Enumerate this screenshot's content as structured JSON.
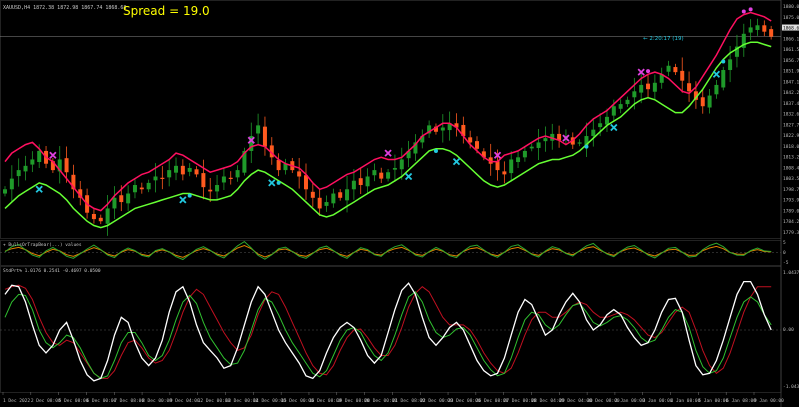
{
  "header": {
    "symbol_line": "XAUUSD,H4 1872.38 1872.98 1867.74 1868.68",
    "spread_label": "Spread = 19.0",
    "timer_label": "← 2:20:17 (19)"
  },
  "colors": {
    "background": "#000000",
    "bull_candle": "#1f9a2a",
    "bear_candle": "#ff5a1f",
    "upper_band": "#ff1060",
    "lower_band": "#66ff33",
    "arrow_cyan": "#22c8e0",
    "arrow_magenta": "#e040e0",
    "spread_text": "#ffff00",
    "axis_text": "#bbbbbb"
  },
  "chart_data": [
    {
      "type": "candlestick",
      "panel": "main",
      "title": "XAUUSD,H4",
      "y_ticks": [
        "1880.00",
        "1875.00",
        "1868.68",
        "1866.15",
        "1861.50",
        "1856.75",
        "1851.90",
        "1847.10",
        "1842.25",
        "1837.40",
        "1832.60",
        "1827.75",
        "1822.90",
        "1818.05",
        "1813.25",
        "1808.40",
        "1803.55",
        "1798.70",
        "1793.90",
        "1789.05",
        "1784.20",
        "1779.35"
      ],
      "current_price": "1868.68",
      "ylim": [
        1776,
        1884
      ],
      "close": [
        1797,
        1802,
        1806,
        1808,
        1811,
        1815,
        1809,
        1806,
        1811,
        1805,
        1797,
        1793,
        1786,
        1783,
        1782,
        1788,
        1793,
        1791,
        1795,
        1799,
        1797,
        1800,
        1803,
        1802,
        1806,
        1808,
        1804,
        1807,
        1804,
        1798,
        1796,
        1799,
        1803,
        1802,
        1806,
        1815,
        1822,
        1827,
        1817,
        1812,
        1806,
        1809,
        1806,
        1803,
        1797,
        1793,
        1788,
        1791,
        1795,
        1793,
        1797,
        1801,
        1799,
        1803,
        1806,
        1802,
        1805,
        1807,
        1811,
        1815,
        1819,
        1822,
        1827,
        1824,
        1826,
        1828,
        1826,
        1822,
        1819,
        1816,
        1812,
        1809,
        1806,
        1804,
        1811,
        1812,
        1815,
        1817,
        1819,
        1821,
        1823,
        1820,
        1822,
        1818,
        1819,
        1822,
        1825,
        1828,
        1831,
        1836,
        1837,
        1839,
        1843,
        1846,
        1844,
        1847,
        1851,
        1855,
        1852,
        1848,
        1843,
        1839,
        1836,
        1841,
        1846,
        1853,
        1858,
        1864,
        1870,
        1873,
        1874,
        1871,
        1868.68
      ],
      "series": [
        {
          "name": "upper_band",
          "values": [
            1810,
            1814,
            1816,
            1818,
            1819,
            1816,
            1812,
            1810,
            1806,
            1802,
            1798,
            1794,
            1790,
            1788,
            1787,
            1790,
            1794,
            1797,
            1800,
            1802,
            1804,
            1805,
            1807,
            1809,
            1811,
            1814,
            1813,
            1811,
            1809,
            1807,
            1805,
            1806,
            1807,
            1808,
            1810,
            1814,
            1817,
            1818,
            1817,
            1814,
            1811,
            1809,
            1808,
            1807,
            1804,
            1800,
            1797,
            1798,
            1800,
            1802,
            1804,
            1805,
            1807,
            1809,
            1811,
            1812,
            1811,
            1811,
            1812,
            1815,
            1818,
            1822,
            1824,
            1826,
            1828,
            1828,
            1826,
            1822,
            1818,
            1815,
            1812,
            1810,
            1810,
            1813,
            1814,
            1815,
            1817,
            1819,
            1821,
            1822,
            1821,
            1820,
            1818,
            1820,
            1823,
            1827,
            1830,
            1832,
            1834,
            1837,
            1840,
            1843,
            1846,
            1849,
            1851,
            1852,
            1851,
            1849,
            1846,
            1843,
            1842,
            1845,
            1850,
            1855,
            1860,
            1866,
            1872,
            1877,
            1879,
            1880,
            1879,
            1878,
            1876
          ]
        },
        {
          "name": "lower_band",
          "values": [
            1788,
            1791,
            1794,
            1796,
            1798,
            1800,
            1799,
            1797,
            1795,
            1792,
            1788,
            1785,
            1782,
            1780,
            1779,
            1780,
            1782,
            1784,
            1786,
            1788,
            1789,
            1790,
            1791,
            1792,
            1793,
            1794,
            1795,
            1795,
            1794,
            1793,
            1792,
            1792,
            1793,
            1794,
            1797,
            1801,
            1804,
            1806,
            1805,
            1803,
            1801,
            1799,
            1797,
            1794,
            1791,
            1788,
            1785,
            1784,
            1785,
            1787,
            1789,
            1791,
            1793,
            1795,
            1797,
            1798,
            1799,
            1801,
            1803,
            1806,
            1809,
            1812,
            1815,
            1816,
            1816,
            1815,
            1813,
            1810,
            1807,
            1804,
            1801,
            1799,
            1798,
            1799,
            1801,
            1803,
            1805,
            1807,
            1809,
            1810,
            1811,
            1811,
            1812,
            1813,
            1815,
            1818,
            1821,
            1824,
            1827,
            1829,
            1831,
            1834,
            1837,
            1839,
            1840,
            1839,
            1837,
            1835,
            1833,
            1833,
            1836,
            1840,
            1844,
            1849,
            1854,
            1858,
            1861,
            1863,
            1865,
            1866,
            1866,
            1865,
            1864
          ]
        }
      ]
    },
    {
      "type": "line",
      "panel": "oscillator",
      "title": "+ BullsOrTrapBear(...) values",
      "y_ticks": [
        "5",
        "0",
        "-5"
      ],
      "series": [
        {
          "name": "green",
          "values": [
            0.2,
            1.8,
            2.5,
            0.8,
            -0.8,
            -1.5,
            0.5,
            1.6,
            0.4,
            -1.2,
            -1.8,
            -0.4,
            1.1,
            2.3,
            0.9,
            -0.8,
            -1.6,
            0.3,
            1.4,
            0.6,
            -0.9,
            -1.4,
            0.6,
            1.2,
            0.2,
            -1.3,
            -2.2,
            -0.6,
            1.0,
            1.8,
            0.7,
            -0.8,
            -1.7,
            0.2,
            2.1,
            3.4,
            1.4,
            -0.9,
            -2.1,
            -0.7,
            1.2,
            1.7,
            0.3,
            -1.2,
            -1.8,
            -0.3,
            1.4,
            2.0,
            0.6,
            -0.9,
            -1.8,
            0.0,
            1.5,
            0.9,
            -0.7,
            -1.2,
            0.7,
            1.8,
            2.4,
            0.9,
            -0.8,
            -1.4,
            0.3,
            1.6,
            0.6,
            -1.0,
            -1.6,
            0.4,
            1.9,
            2.3,
            0.8,
            -0.7,
            -1.5,
            0.1,
            1.9,
            2.4,
            1.0,
            -0.6,
            -1.4,
            0.5,
            1.8,
            1.2,
            -0.3,
            -1.1,
            0.6,
            2.1,
            2.8,
            1.0,
            -0.5,
            -1.3,
            0.4,
            1.7,
            2.2,
            0.8,
            -0.8,
            -1.7,
            -0.2,
            1.3,
            1.6,
            0.1,
            -1.4,
            -1.2,
            0.9,
            2.2,
            2.9,
            1.8,
            0.0,
            -0.8,
            -0.9,
            0.6,
            1.4,
            0.5,
            0.3
          ]
        },
        {
          "name": "orange",
          "values": [
            0.4,
            1.2,
            1.6,
            0.9,
            -0.3,
            -1.0,
            0.1,
            1.0,
            0.5,
            -0.7,
            -1.2,
            -0.3,
            0.7,
            1.5,
            0.8,
            -0.5,
            -1.1,
            0.1,
            0.9,
            0.4,
            -0.6,
            -1.0,
            0.3,
            0.8,
            0.2,
            -0.9,
            -1.5,
            -0.5,
            0.6,
            1.2,
            0.6,
            -0.5,
            -1.1,
            0.1,
            1.4,
            2.2,
            1.2,
            -0.5,
            -1.4,
            -0.6,
            0.8,
            1.1,
            0.3,
            -0.8,
            -1.2,
            -0.2,
            0.9,
            1.3,
            0.5,
            -0.6,
            -1.2,
            0.0,
            1.0,
            0.6,
            -0.5,
            -0.8,
            0.4,
            1.2,
            1.6,
            0.7,
            -0.5,
            -0.9,
            0.2,
            1.0,
            0.4,
            -0.7,
            -1.1,
            0.3,
            1.2,
            1.5,
            0.6,
            -0.5,
            -1.0,
            0.1,
            1.2,
            1.6,
            0.7,
            -0.4,
            -0.9,
            0.3,
            1.2,
            0.8,
            -0.2,
            -0.7,
            0.4,
            1.4,
            1.8,
            0.7,
            -0.3,
            -0.9,
            0.3,
            1.1,
            1.4,
            0.5,
            -0.5,
            -1.1,
            -0.1,
            0.8,
            1.0,
            0.1,
            -0.9,
            -0.8,
            0.6,
            1.4,
            1.9,
            1.2,
            0.0,
            -0.5,
            -0.6,
            0.4,
            0.9,
            0.3,
            0.2
          ]
        }
      ]
    },
    {
      "type": "line",
      "panel": "stochastic",
      "title": "StdPrt% 1.0176 0.2541 -0.4697 0.0500",
      "y_ticks": [
        "1.04372",
        "0.00",
        "-1.04372"
      ],
      "ylim": [
        -1.1,
        1.1
      ],
      "series": [
        {
          "name": "white",
          "values": [
            0.7,
            0.88,
            0.85,
            0.55,
            0.1,
            -0.3,
            -0.45,
            -0.3,
            0.0,
            0.15,
            -0.2,
            -0.6,
            -0.88,
            -1.0,
            -0.95,
            -0.6,
            -0.1,
            0.25,
            0.15,
            -0.25,
            -0.55,
            -0.7,
            -0.55,
            -0.2,
            0.35,
            0.75,
            0.85,
            0.55,
            0.1,
            -0.25,
            -0.4,
            -0.55,
            -0.75,
            -0.7,
            -0.35,
            0.1,
            0.55,
            0.85,
            0.7,
            0.35,
            0.0,
            -0.25,
            -0.45,
            -0.65,
            -0.9,
            -0.95,
            -0.8,
            -0.45,
            -0.15,
            0.05,
            0.15,
            0.05,
            -0.2,
            -0.5,
            -0.65,
            -0.5,
            -0.05,
            0.4,
            0.78,
            0.92,
            0.7,
            0.25,
            -0.15,
            -0.3,
            -0.15,
            0.05,
            0.15,
            0.0,
            -0.3,
            -0.6,
            -0.8,
            -0.9,
            -0.85,
            -0.55,
            -0.1,
            0.35,
            0.6,
            0.5,
            0.2,
            -0.1,
            0.0,
            0.3,
            0.55,
            0.72,
            0.55,
            0.2,
            0.0,
            0.1,
            0.3,
            0.4,
            0.3,
            0.05,
            -0.15,
            -0.3,
            -0.25,
            0.0,
            0.35,
            0.6,
            0.62,
            0.35,
            -0.2,
            -0.7,
            -0.88,
            -0.85,
            -0.6,
            -0.2,
            0.25,
            0.7,
            0.95,
            0.95,
            0.7,
            0.3,
            0.0
          ]
        },
        {
          "name": "green",
          "values": [
            0.25,
            0.55,
            0.7,
            0.68,
            0.4,
            0.0,
            -0.25,
            -0.35,
            -0.25,
            -0.1,
            -0.15,
            -0.35,
            -0.62,
            -0.85,
            -0.95,
            -0.9,
            -0.6,
            -0.25,
            -0.05,
            -0.05,
            -0.25,
            -0.5,
            -0.6,
            -0.5,
            -0.2,
            0.2,
            0.55,
            0.68,
            0.52,
            0.15,
            -0.15,
            -0.35,
            -0.55,
            -0.68,
            -0.65,
            -0.4,
            0.0,
            0.4,
            0.62,
            0.55,
            0.3,
            0.0,
            -0.25,
            -0.45,
            -0.65,
            -0.85,
            -0.92,
            -0.8,
            -0.5,
            -0.2,
            0.0,
            0.05,
            -0.05,
            -0.3,
            -0.5,
            -0.6,
            -0.45,
            -0.1,
            0.3,
            0.65,
            0.75,
            0.55,
            0.2,
            -0.05,
            -0.15,
            -0.1,
            0.02,
            0.05,
            -0.1,
            -0.35,
            -0.6,
            -0.78,
            -0.9,
            -0.85,
            -0.55,
            -0.15,
            0.2,
            0.35,
            0.3,
            0.1,
            0.0,
            0.1,
            0.3,
            0.48,
            0.52,
            0.35,
            0.15,
            0.08,
            0.15,
            0.25,
            0.28,
            0.2,
            0.05,
            -0.15,
            -0.25,
            -0.2,
            0.0,
            0.25,
            0.4,
            0.35,
            0.05,
            -0.4,
            -0.72,
            -0.85,
            -0.8,
            -0.55,
            -0.15,
            0.25,
            0.55,
            0.65,
            0.55,
            0.3,
            0.1
          ]
        },
        {
          "name": "red",
          "values": [
            0.8,
            0.85,
            0.88,
            0.82,
            0.6,
            0.25,
            -0.05,
            -0.25,
            -0.3,
            -0.2,
            -0.25,
            -0.45,
            -0.65,
            -0.85,
            -0.95,
            -0.95,
            -0.8,
            -0.5,
            -0.25,
            -0.2,
            -0.35,
            -0.55,
            -0.65,
            -0.6,
            -0.4,
            -0.05,
            0.35,
            0.65,
            0.8,
            0.7,
            0.45,
            0.2,
            -0.05,
            -0.25,
            -0.4,
            -0.35,
            -0.1,
            0.3,
            0.6,
            0.75,
            0.7,
            0.45,
            0.15,
            -0.15,
            -0.45,
            -0.7,
            -0.85,
            -0.88,
            -0.7,
            -0.4,
            -0.15,
            0.0,
            0.02,
            -0.15,
            -0.35,
            -0.5,
            -0.5,
            -0.3,
            0.05,
            0.45,
            0.72,
            0.85,
            0.75,
            0.5,
            0.25,
            0.1,
            0.1,
            0.1,
            0.0,
            -0.2,
            -0.45,
            -0.65,
            -0.8,
            -0.85,
            -0.75,
            -0.45,
            -0.1,
            0.2,
            0.35,
            0.35,
            0.25,
            0.25,
            0.35,
            0.48,
            0.55,
            0.5,
            0.35,
            0.25,
            0.25,
            0.3,
            0.35,
            0.3,
            0.2,
            0.05,
            -0.1,
            -0.15,
            -0.05,
            0.15,
            0.35,
            0.45,
            0.35,
            0.0,
            -0.4,
            -0.7,
            -0.85,
            -0.75,
            -0.45,
            -0.05,
            0.35,
            0.65,
            0.85,
            0.85,
            0.85
          ]
        }
      ]
    }
  ],
  "x_axis": {
    "labels": [
      "1 Dec 2022",
      "2 Dec 08:00",
      "5 Dec 08:00",
      "6 Dec 00:00",
      "7 Dec 08:00",
      "8 Dec 00:00",
      "9 Dec 04:00",
      "12 Dec 00:00",
      "13 Dec 00:00",
      "14 Dec 00:00",
      "15 Dec 00:00",
      "16 Dec 08:00",
      "19 Dec 08:00",
      "20 Dec 00:00",
      "21 Dec 08:00",
      "22 Dec 00:00",
      "23 Dec 08:00",
      "26 Dec 08:00",
      "27 Dec 00:00",
      "28 Dec 04:00",
      "29 Dec 04:00",
      "30 Dec 08:00",
      "2 Jan 00:00",
      "3 Jan 00:00",
      "4 Jan 08:00",
      "5 Jan 00:00",
      "6 Jan 08:00",
      "9 Jan 00:00"
    ]
  },
  "markers": {
    "cyan_x_bars": [
      5,
      26,
      39,
      59,
      66,
      89,
      104
    ],
    "magenta_x_bars": [
      7,
      36,
      56,
      72,
      82,
      93
    ],
    "cyan_arrow_bars": [
      27,
      40,
      63,
      85,
      105
    ],
    "magenta_arrow_bars": [
      94,
      108,
      109
    ]
  }
}
